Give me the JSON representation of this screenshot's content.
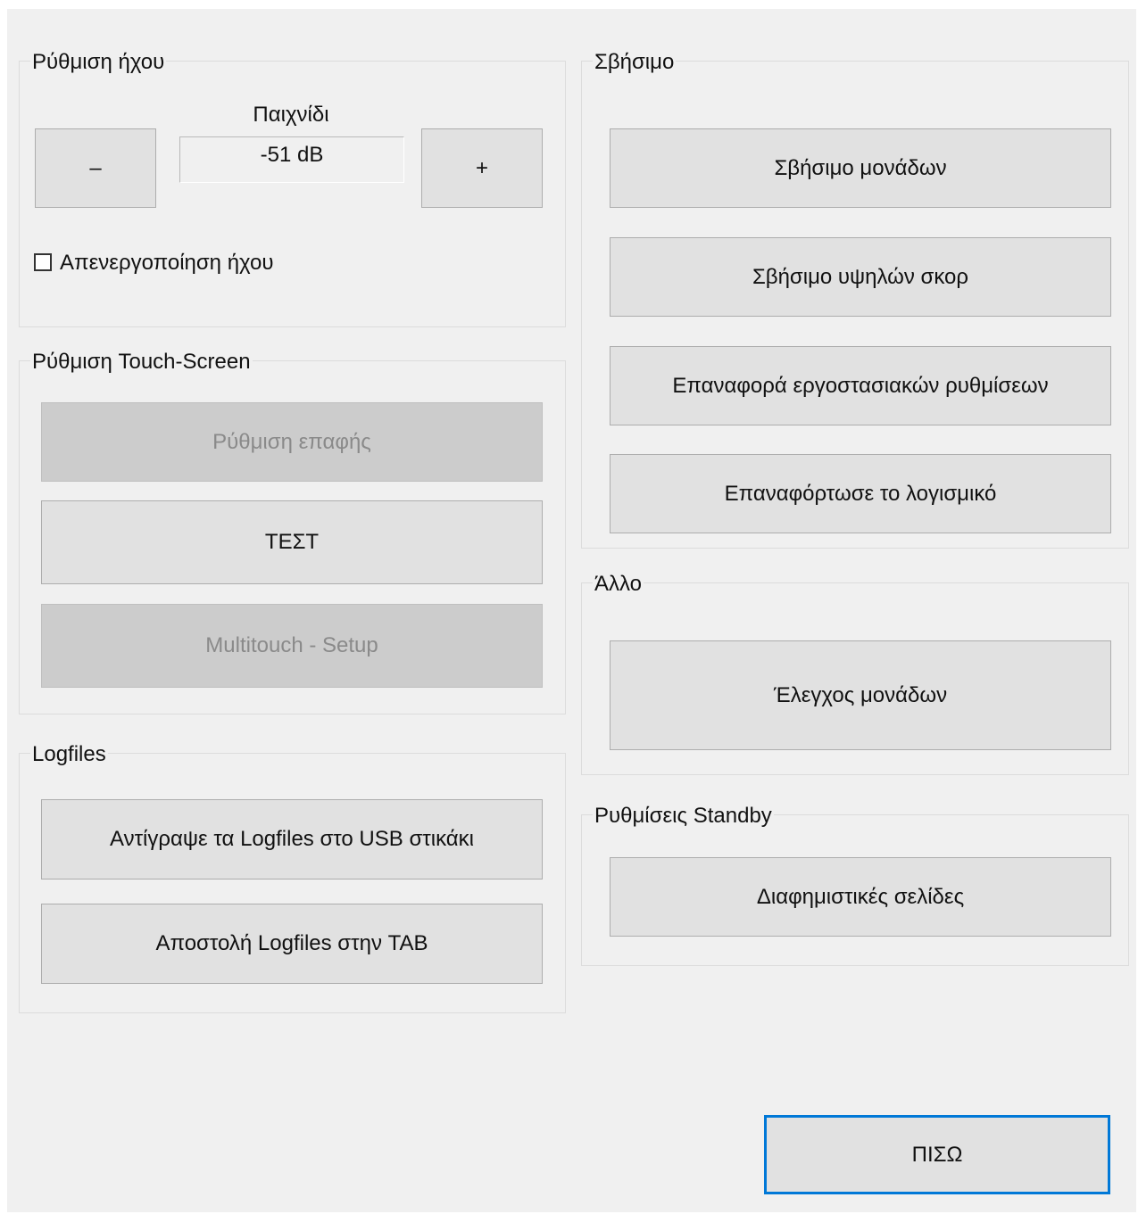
{
  "sound": {
    "legend": "Ρύθμιση ήχου",
    "game_label": "Παιχνίδι",
    "volume_value": "-51 dB",
    "minus_label": "–",
    "plus_label": "+",
    "mute_label": "Απενεργοποίηση ήχου",
    "mute_checked": false
  },
  "touch": {
    "legend": "Ρύθμιση Touch-Screen",
    "calibrate_label": "Ρύθμιση επαφής",
    "test_label": "ΤΕΣΤ",
    "multitouch_label": "Multitouch - Setup"
  },
  "logfiles": {
    "legend": "Logfiles",
    "copy_usb_label": "Αντίγραψε τα Logfiles στο USB στικάκι",
    "send_tab_label": "Αποστολή Logfiles στην TAB"
  },
  "erase": {
    "legend": "Σβήσιμο",
    "erase_credits_label": "Σβήσιμο μονάδων",
    "erase_highscores_label": "Σβήσιμο υψηλών σκορ",
    "factory_reset_label": "Επαναφορά εργοστασιακών ρυθμίσεων",
    "reload_software_label": "Επαναφόρτωσε το λογισμικό"
  },
  "other": {
    "legend": "Άλλο",
    "check_credits_label": "Έλεγχος μονάδων"
  },
  "standby": {
    "legend": "Ρυθμίσεις Standby",
    "ad_pages_label": "Διαφημιστικές σελίδες"
  },
  "footer": {
    "back_label": "ΠΙΣΩ"
  },
  "colors": {
    "accent": "#0078d7",
    "window_bg": "#f0f0f0",
    "button_bg": "#e1e1e1",
    "disabled_bg": "#cccccc"
  }
}
